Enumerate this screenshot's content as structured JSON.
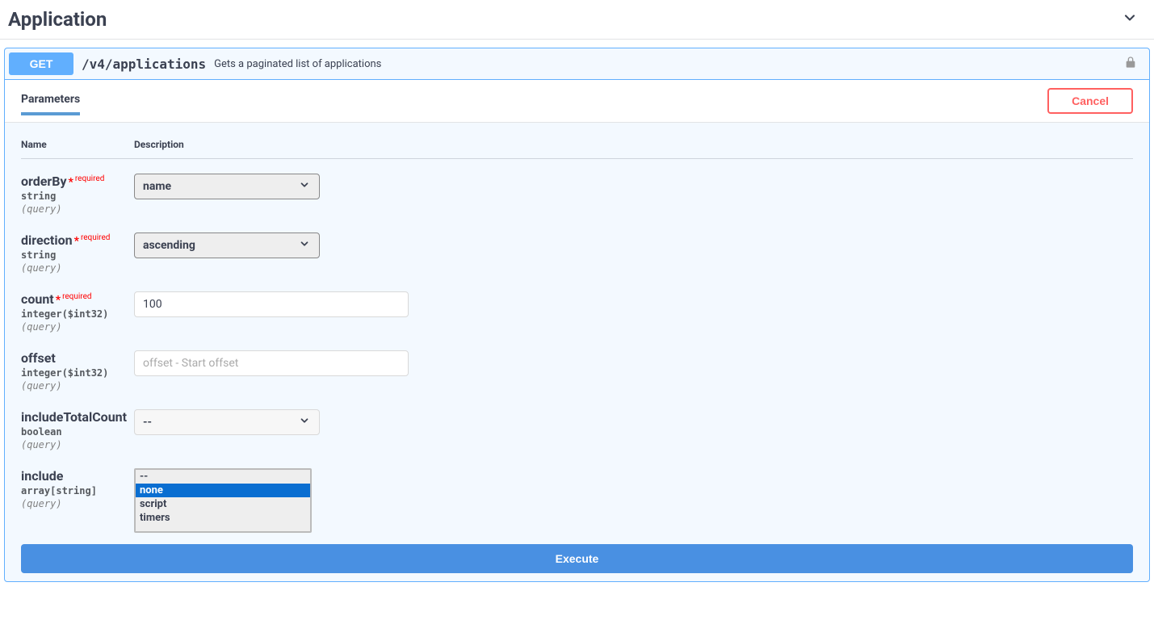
{
  "section": {
    "title": "Application"
  },
  "op": {
    "method": "GET",
    "path": "/v4/applications",
    "summary": "Gets a paginated list of applications"
  },
  "ui": {
    "parameters_tab": "Parameters",
    "cancel": "Cancel",
    "execute": "Execute",
    "col_name": "Name",
    "col_desc": "Description",
    "required": "required"
  },
  "params": {
    "orderBy": {
      "name": "orderBy",
      "type": "string",
      "in": "(query)",
      "required": true,
      "value": "name"
    },
    "direction": {
      "name": "direction",
      "type": "string",
      "in": "(query)",
      "required": true,
      "value": "ascending"
    },
    "count": {
      "name": "count",
      "type": "integer($int32)",
      "in": "(query)",
      "required": true,
      "value": "100"
    },
    "offset": {
      "name": "offset",
      "type": "integer($int32)",
      "in": "(query)",
      "required": false,
      "placeholder": "offset - Start offset"
    },
    "includeTotalCount": {
      "name": "includeTotalCount",
      "type": "boolean",
      "in": "(query)",
      "required": false,
      "value": "--"
    },
    "include": {
      "name": "include",
      "type": "array[string]",
      "in": "(query)",
      "required": false,
      "options": [
        "--",
        "none",
        "script",
        "timers"
      ],
      "selected": "none"
    }
  }
}
